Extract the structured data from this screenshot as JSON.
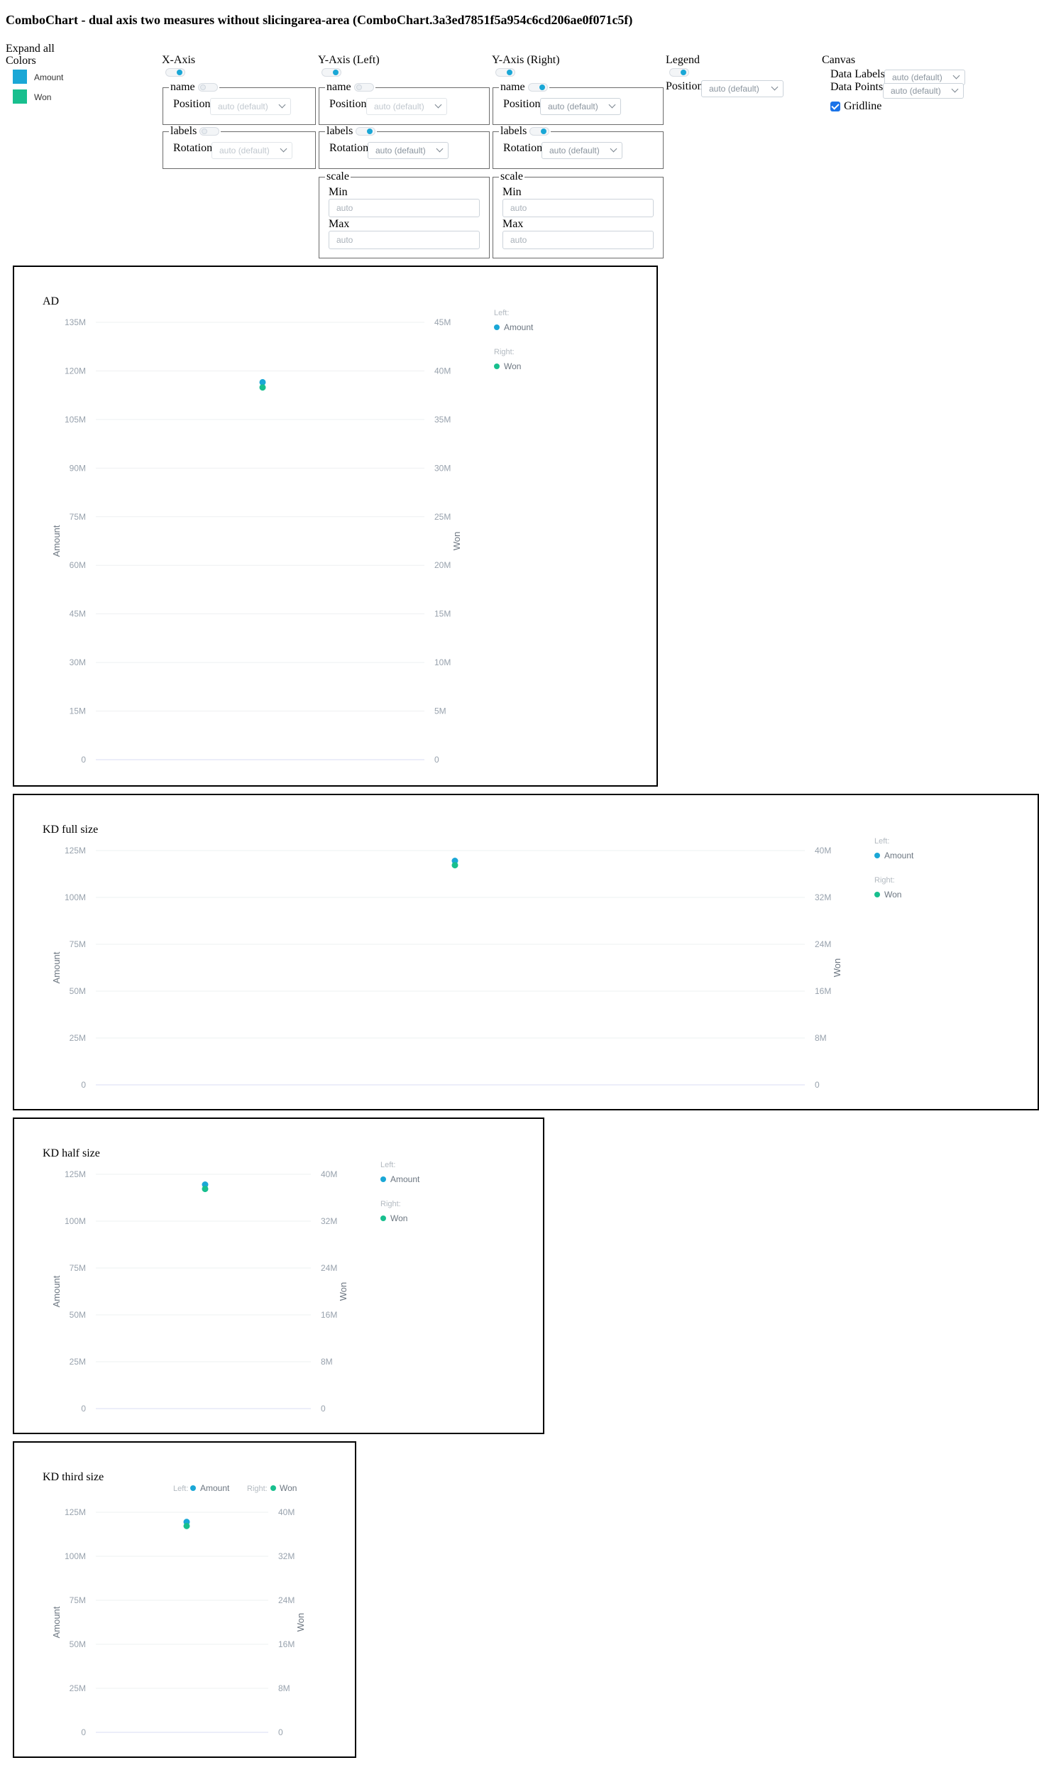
{
  "page_title": "ComboChart - dual axis two measures without slicingarea-area (ComboChart.3a3ed7851f5a954c6cd206ae0f071c5f)",
  "controls": {
    "expand_all": "Expand all",
    "colors_label": "Colors",
    "colors": [
      {
        "name": "Amount",
        "color": "#1aa7d6"
      },
      {
        "name": "Won",
        "color": "#18bf8e"
      }
    ],
    "x_axis": {
      "title": "X-Axis",
      "enabled": true,
      "name_box": "name",
      "name_enabled": false,
      "position_label": "Position",
      "position_value": "auto (default)",
      "labels_box": "labels",
      "labels_enabled": false,
      "rotation_label": "Rotation",
      "rotation_value": "auto (default)"
    },
    "y_left": {
      "title": "Y-Axis (Left)",
      "enabled": true,
      "name_box": "name",
      "name_enabled": false,
      "position_label": "Position",
      "position_value": "auto (default)",
      "labels_box": "labels",
      "labels_enabled": true,
      "rotation_label": "Rotation",
      "rotation_value": "auto (default)",
      "scale_box": "scale",
      "min_label": "Min",
      "min_placeholder": "auto",
      "max_label": "Max",
      "max_placeholder": "auto"
    },
    "y_right": {
      "title": "Y-Axis (Right)",
      "enabled": true,
      "name_box": "name",
      "name_enabled": true,
      "position_label": "Position",
      "position_value": "auto (default)",
      "labels_box": "labels",
      "labels_enabled": true,
      "rotation_label": "Rotation",
      "rotation_value": "auto (default)",
      "scale_box": "scale",
      "min_label": "Min",
      "min_placeholder": "auto",
      "max_label": "Max",
      "max_placeholder": "auto"
    },
    "legend": {
      "title": "Legend",
      "enabled": true,
      "position_label": "Position",
      "position_value": "auto (default)"
    },
    "canvas": {
      "title": "Canvas",
      "data_labels_label": "Data Labels",
      "data_labels_value": "auto (default)",
      "data_points_label": "Data Points",
      "data_points_value": "auto (default)",
      "gridline_label": "Gridline",
      "gridline_checked": true
    }
  },
  "chart_data": [
    {
      "type": "scatter",
      "title": "AD",
      "ylabel": "Amount",
      "y2label": "Won",
      "ylim": [
        0,
        135000000
      ],
      "y2lim": [
        0,
        45000000
      ],
      "y_ticks": [
        "0",
        "15M",
        "30M",
        "45M",
        "60M",
        "75M",
        "90M",
        "105M",
        "120M",
        "135M"
      ],
      "y2_ticks": [
        "0",
        "5M",
        "10M",
        "15M",
        "20M",
        "25M",
        "30M",
        "35M",
        "40M",
        "45M"
      ],
      "legend_left": "Left:",
      "legend_right": "Right:",
      "legend_position": "right",
      "grid": true,
      "series": [
        {
          "name": "Amount",
          "axis": "left",
          "color": "#1aa7d6",
          "values": [
            116500000
          ]
        },
        {
          "name": "Won",
          "axis": "right",
          "color": "#18bf8e",
          "values": [
            38300000
          ]
        }
      ]
    },
    {
      "type": "scatter",
      "title": "KD full size",
      "ylabel": "Amount",
      "y2label": "Won",
      "ylim": [
        0,
        125000000
      ],
      "y2lim": [
        0,
        40000000
      ],
      "y_ticks": [
        "0",
        "25M",
        "50M",
        "75M",
        "100M",
        "125M"
      ],
      "y2_ticks": [
        "0",
        "8M",
        "16M",
        "24M",
        "32M",
        "40M"
      ],
      "legend_left": "Left:",
      "legend_right": "Right:",
      "legend_position": "right",
      "grid": true,
      "series": [
        {
          "name": "Amount",
          "axis": "left",
          "color": "#1aa7d6",
          "values": [
            119500000
          ]
        },
        {
          "name": "Won",
          "axis": "right",
          "color": "#18bf8e",
          "values": [
            37500000
          ]
        }
      ]
    },
    {
      "type": "scatter",
      "title": "KD half size",
      "ylabel": "Amount",
      "y2label": "Won",
      "ylim": [
        0,
        125000000
      ],
      "y2lim": [
        0,
        40000000
      ],
      "y_ticks": [
        "0",
        "25M",
        "50M",
        "75M",
        "100M",
        "125M"
      ],
      "y2_ticks": [
        "0",
        "8M",
        "16M",
        "24M",
        "32M",
        "40M"
      ],
      "legend_left": "Left:",
      "legend_right": "Right:",
      "legend_position": "right",
      "grid": true,
      "series": [
        {
          "name": "Amount",
          "axis": "left",
          "color": "#1aa7d6",
          "values": [
            119500000
          ]
        },
        {
          "name": "Won",
          "axis": "right",
          "color": "#18bf8e",
          "values": [
            37500000
          ]
        }
      ]
    },
    {
      "type": "scatter",
      "title": "KD third size",
      "ylabel": "Amount",
      "y2label": "Won",
      "ylim": [
        0,
        125000000
      ],
      "y2lim": [
        0,
        40000000
      ],
      "y_ticks": [
        "0",
        "25M",
        "50M",
        "75M",
        "100M",
        "125M"
      ],
      "y2_ticks": [
        "0",
        "8M",
        "16M",
        "24M",
        "32M",
        "40M"
      ],
      "legend_left": "Left:",
      "legend_right": "Right:",
      "legend_position": "top",
      "grid": true,
      "series": [
        {
          "name": "Amount",
          "axis": "left",
          "color": "#1aa7d6",
          "values": [
            119500000
          ]
        },
        {
          "name": "Won",
          "axis": "right",
          "color": "#18bf8e",
          "values": [
            37500000
          ]
        }
      ]
    }
  ]
}
